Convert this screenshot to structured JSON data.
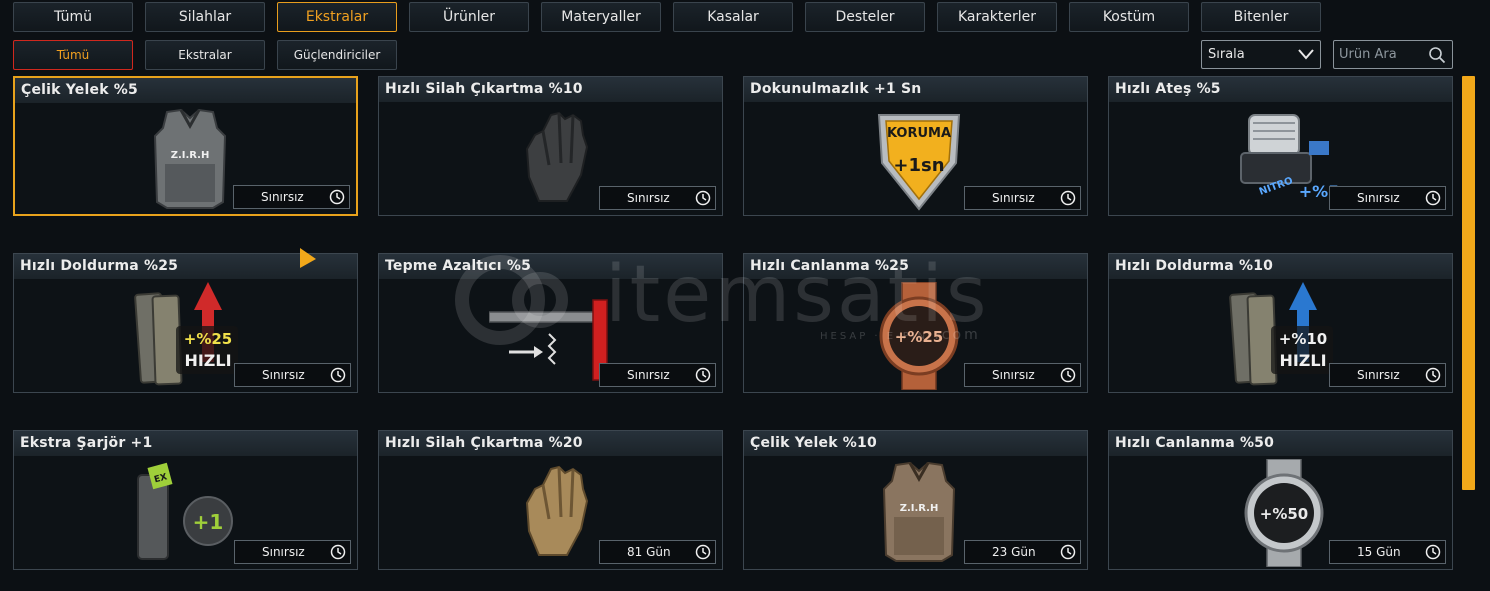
{
  "tabs": [
    {
      "label": "Tümü",
      "active": false
    },
    {
      "label": "Silahlar",
      "active": false
    },
    {
      "label": "Ekstralar",
      "active": true
    },
    {
      "label": "Ürünler",
      "active": false
    },
    {
      "label": "Materyaller",
      "active": false
    },
    {
      "label": "Kasalar",
      "active": false
    },
    {
      "label": "Desteler",
      "active": false
    },
    {
      "label": "Karakterler",
      "active": false
    },
    {
      "label": "Kostüm",
      "active": false
    },
    {
      "label": "Bitenler",
      "active": false
    }
  ],
  "subtabs": [
    {
      "label": "Tümü",
      "active": true
    },
    {
      "label": "Ekstralar",
      "active": false
    },
    {
      "label": "Güçlendiriciler",
      "active": false
    }
  ],
  "sort": {
    "label": "Sırala"
  },
  "search": {
    "placeholder": "Ürün Ara"
  },
  "items": [
    {
      "title": "Çelik Yelek %5",
      "duration": "Sınırsız",
      "icon": "vest-icon",
      "selected": true
    },
    {
      "title": "Hızlı Silah Çıkartma %10",
      "duration": "Sınırsız",
      "icon": "glove-dark-icon"
    },
    {
      "title": "Dokunulmazlık +1 Sn",
      "duration": "Sınırsız",
      "icon": "shield-icon"
    },
    {
      "title": "Hızlı Ateş %5",
      "duration": "Sınırsız",
      "icon": "nitro-engine-icon"
    },
    {
      "title": "Hızlı Doldurma %25",
      "duration": "Sınırsız",
      "icon": "magazine-red-icon"
    },
    {
      "title": "Tepme Azaltıcı %5",
      "duration": "Sınırsız",
      "icon": "stock-icon"
    },
    {
      "title": "Hızlı Canlanma %25",
      "duration": "Sınırsız",
      "icon": "watch-bronze-icon"
    },
    {
      "title": "Hızlı Doldurma %10",
      "duration": "Sınırsız",
      "icon": "magazine-blue-icon"
    },
    {
      "title": "Ekstra Şarjör +1",
      "duration": "Sınırsız",
      "icon": "mag-pouch-icon"
    },
    {
      "title": "Hızlı Silah Çıkartma %20",
      "duration": "81 Gün",
      "icon": "glove-tan-icon"
    },
    {
      "title": "Çelik Yelek %10",
      "duration": "23 Gün",
      "icon": "vest-tan-icon"
    },
    {
      "title": "Hızlı Canlanma %50",
      "duration": "15 Gün",
      "icon": "watch-silver-icon"
    }
  ],
  "art": {
    "vest": "Z.I.R.H",
    "shield_top": "KORUMA",
    "shield_value": "+1sn",
    "nitro": "NITRO",
    "nitro_value": "+%5",
    "mag_red_value": "+%25",
    "mag_blue_value": "+%10",
    "mag_label": "HIZLI",
    "pouch_value": "+1",
    "pouch_tag": "EX",
    "watch_bronze_value": "+%25",
    "watch_silver_value": "+%50"
  },
  "watermark": {
    "text": "itemsatis",
    "sub": "HESAP · E-PIN",
    "suffix": ".com"
  },
  "colors": {
    "accent": "#e8a21c",
    "active_subtab_border": "#d0281e",
    "scrollbar": "#f2a81a"
  }
}
